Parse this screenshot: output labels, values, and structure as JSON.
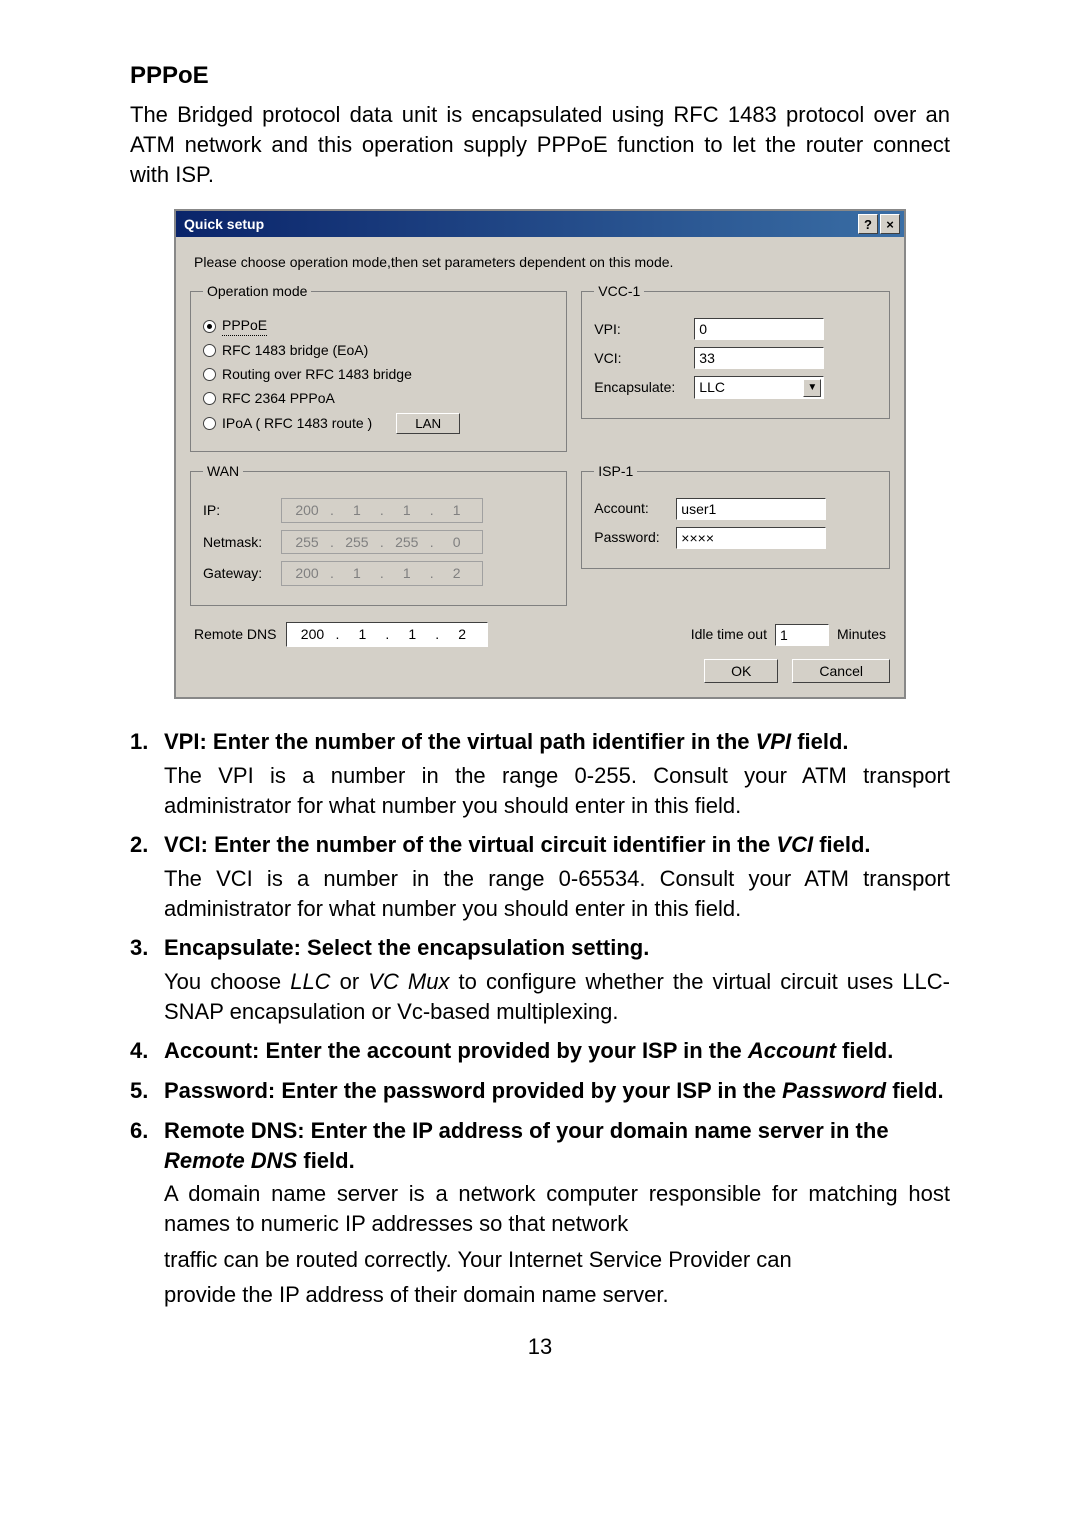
{
  "section_title": "PPPoE",
  "intro": "The Bridged protocol data unit is encapsulated using RFC 1483 protocol over an ATM network and this operation supply PPPoE function to let the router connect with ISP.",
  "dialog": {
    "title": "Quick setup",
    "help_glyph": "?",
    "close_glyph": "×",
    "caption": "Please choose operation mode,then set parameters dependent on  this mode.",
    "operation_mode": {
      "legend": "Operation mode",
      "options": [
        {
          "label": "PPPoE",
          "selected": true
        },
        {
          "label": "RFC 1483 bridge (EoA)",
          "selected": false
        },
        {
          "label": "Routing over RFC 1483 bridge",
          "selected": false
        },
        {
          "label": "RFC 2364 PPPoA",
          "selected": false
        },
        {
          "label": "IPoA ( RFC 1483 route )",
          "selected": false
        }
      ],
      "lan_button": "LAN"
    },
    "vcc": {
      "legend": "VCC-1",
      "vpi_label": "VPI:",
      "vpi_value": "0",
      "vci_label": "VCI:",
      "vci_value": "33",
      "encap_label": "Encapsulate:",
      "encap_value": "LLC"
    },
    "wan": {
      "legend": "WAN",
      "ip_label": "IP:",
      "ip": [
        "200",
        "1",
        "1",
        "1"
      ],
      "netmask_label": "Netmask:",
      "netmask": [
        "255",
        "255",
        "255",
        "0"
      ],
      "gateway_label": "Gateway:",
      "gateway": [
        "200",
        "1",
        "1",
        "2"
      ]
    },
    "isp": {
      "legend": "ISP-1",
      "account_label": "Account:",
      "account_value": "user1",
      "password_label": "Password:",
      "password_value": "××××"
    },
    "remote_dns_label": "Remote DNS",
    "remote_dns": [
      "200",
      "1",
      "1",
      "2"
    ],
    "idle_label": "Idle time out",
    "idle_value": "1",
    "idle_unit": "Minutes",
    "ok": "OK",
    "cancel": "Cancel"
  },
  "items": [
    {
      "num": "1.",
      "head_prefix": "VPI: Enter the number of the virtual path identifier in the ",
      "head_em": "VPI",
      "head_suffix": " field.",
      "body": "The VPI is a number in the range 0-255. Consult your ATM transport administrator for what number you should enter in this field."
    },
    {
      "num": "2.",
      "head_prefix": "VCI: Enter the number of the virtual circuit identifier in the ",
      "head_em": "VCI",
      "head_suffix": " field.",
      "body_pre": "The VCI is a number in the range 0-65534. Consult your ATM transport administrator for what number you should enter in this field."
    },
    {
      "num": "3.",
      "head_full": "Encapsulate: Select the encapsulation setting.",
      "body_a": "You choose ",
      "body_em1": "LLC",
      "body_b": " or ",
      "body_em2": "VC Mux",
      "body_c": " to configure whether the virtual circuit uses LLC-SNAP encapsulation or Vc-based multiplexing."
    },
    {
      "num": "4.",
      "head_prefix": "Account: Enter the account provided by your ISP in the ",
      "head_em": "Account",
      "head_suffix": " field."
    },
    {
      "num": "5.",
      "head_prefix": "Password: Enter the password provided by your ISP in the ",
      "head_em": "Password",
      "head_suffix": " field."
    },
    {
      "num": "6.",
      "head_prefix": "Remote DNS: Enter the IP address of your domain name server in the ",
      "head_em": "Remote DNS",
      "head_suffix": "  field.",
      "body6a": "A domain name server is a network computer responsible for matching host names to numeric IP addresses so that network",
      "body6b": "traffic can be routed correctly. Your Internet Service Provider can",
      "body6c": "provide the IP address of their domain name server."
    }
  ],
  "page_number": "13"
}
